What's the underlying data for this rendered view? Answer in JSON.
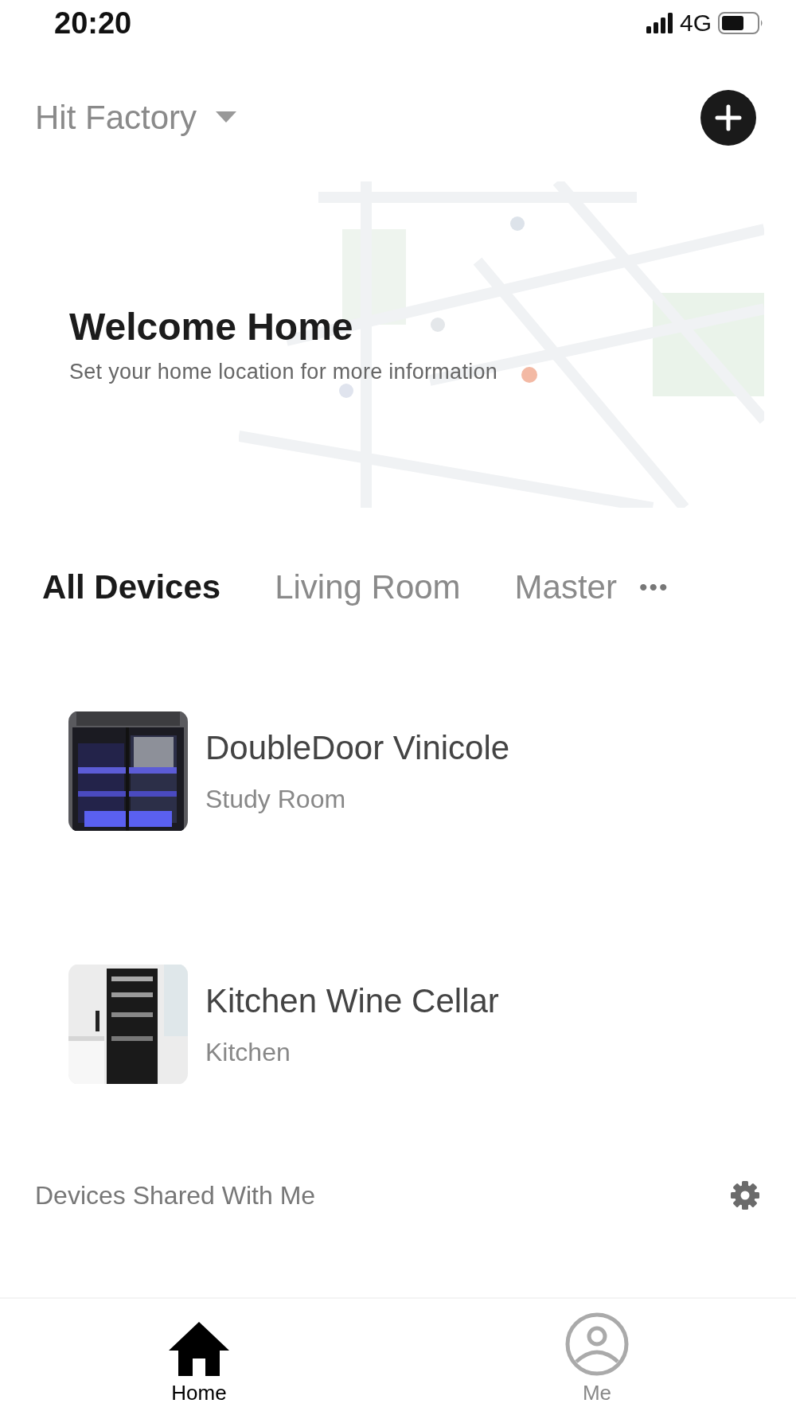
{
  "status_bar": {
    "time": "20:20",
    "network": "4G"
  },
  "header": {
    "home_name": "Hit Factory"
  },
  "banner": {
    "kind": "picture",
    "title": "Welcome Home",
    "subtitle": "Set your home location for more information"
  },
  "room_tabs": [
    {
      "label": "All Devices",
      "selected": true
    },
    {
      "label": "Living Room",
      "selected": false
    },
    {
      "label": "Master",
      "selected": false
    }
  ],
  "more_tabs": "•••",
  "devices": [
    {
      "name": "DoubleDoor Vinicole",
      "room": "Study Room",
      "kind": "double"
    },
    {
      "name": "Kitchen Wine Cellar",
      "room": "Kitchen",
      "kind": "kitchen"
    }
  ],
  "shared": {
    "label": "Devices Shared With Me"
  },
  "tab_bar": [
    {
      "label": "Home",
      "selected": true,
      "kind": "home"
    },
    {
      "label": "Me",
      "selected": false,
      "kind": "me"
    }
  ]
}
